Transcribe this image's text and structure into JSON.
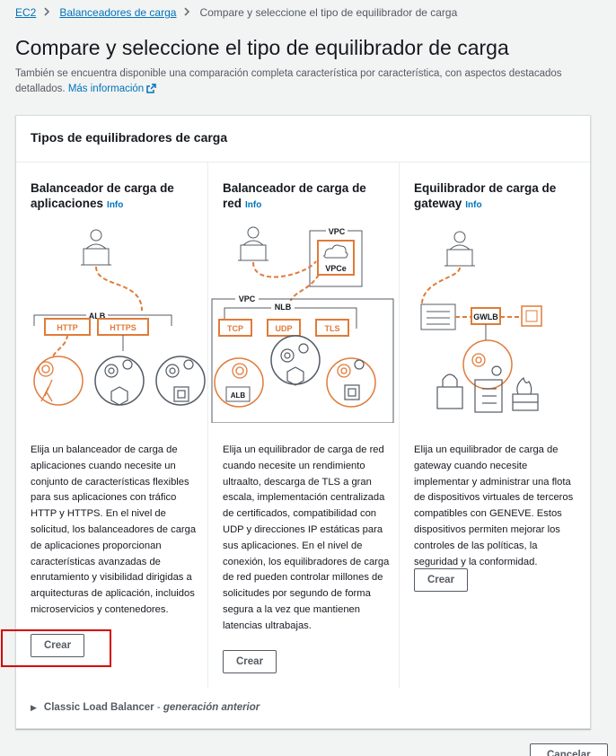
{
  "breadcrumb": {
    "items": [
      {
        "label": "EC2"
      },
      {
        "label": "Balanceadores de carga"
      }
    ],
    "current": "Compare y seleccione el tipo de equilibrador de carga"
  },
  "page": {
    "title": "Compare y seleccione el tipo de equilibrador de carga",
    "description": "También se encuentra disponible una comparación completa característica por característica, con aspectos destacados detallados.",
    "more_info_label": "Más información"
  },
  "section": {
    "title": "Tipos de equilibradores de carga"
  },
  "cards": [
    {
      "title": "Balanceador de carga de aplicaciones",
      "info_label": "Info",
      "description": "Elija un balanceador de carga de aplicaciones cuando necesite un conjunto de características flexibles para sus aplicaciones con tráfico HTTP y HTTPS. En el nivel de solicitud, los balanceadores de carga de aplicaciones proporcionan características avanzadas de enrutamiento y visibilidad dirigidas a arquitecturas de aplicación, incluidos microservicios y contenedores.",
      "button_label": "Crear",
      "diagram": {
        "lb": "ALB",
        "protocols": [
          "HTTP",
          "HTTPS"
        ]
      }
    },
    {
      "title": "Balanceador de carga de red",
      "info_label": "Info",
      "description": "Elija un equilibrador de carga de red cuando necesite un rendimiento ultraalto, descarga de TLS a gran escala, implementación centralizada de certificados, compatibilidad con UDP y direcciones IP estáticas para sus aplicaciones. En el nivel de conexión, los equilibradores de carga de red pueden controlar millones de solicitudes por segundo de forma segura a la vez que mantienen latencias ultrabajas.",
      "button_label": "Crear",
      "diagram": {
        "vpc_top": "VPC",
        "endpoint": "VPCe",
        "vpc": "VPC",
        "lb": "NLB",
        "protocols": [
          "TCP",
          "UDP",
          "TLS"
        ],
        "target": "ALB"
      }
    },
    {
      "title": "Equilibrador de carga de gateway",
      "info_label": "Info",
      "description": "Elija un equilibrador de carga de gateway cuando necesite implementar y administrar una flota de dispositivos virtuales de terceros compatibles con GENEVE. Estos dispositivos permiten mejorar los controles de las políticas, la seguridad y la conformidad.",
      "button_label": "Crear",
      "diagram": {
        "lb": "GWLB"
      }
    }
  ],
  "expander": {
    "title": "Classic Load Balancer",
    "separator": " - ",
    "subtitle": "generación anterior"
  },
  "footer": {
    "cancel_label": "Cancelar"
  },
  "colors": {
    "accent_orange": "#e07b39",
    "link_blue": "#0073bb",
    "highlight_red": "#d50000"
  }
}
